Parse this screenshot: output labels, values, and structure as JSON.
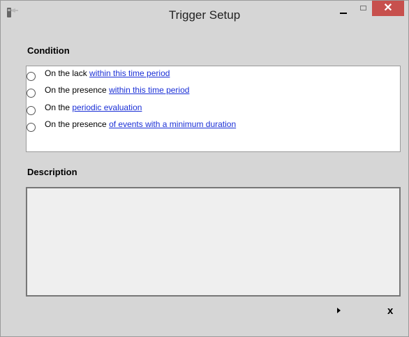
{
  "window": {
    "title": "Trigger Setup",
    "close_glyph": "✕"
  },
  "condition": {
    "label": "Condition",
    "options": [
      {
        "prefix": "On the lack ",
        "link": "within this time period"
      },
      {
        "prefix": "On the presence ",
        "link": "within this time period"
      },
      {
        "prefix": "On the ",
        "link": "periodic evaluation"
      },
      {
        "prefix": "On the presence ",
        "link": "of events with a minimum duration"
      }
    ]
  },
  "description": {
    "label": "Description",
    "text": ""
  },
  "footer": {
    "close_label": "x"
  },
  "icons": {
    "app": "plug-icon",
    "next": "play-arrow-icon"
  },
  "colors": {
    "link": "#1a2fd6",
    "close_button": "#c7504d"
  }
}
